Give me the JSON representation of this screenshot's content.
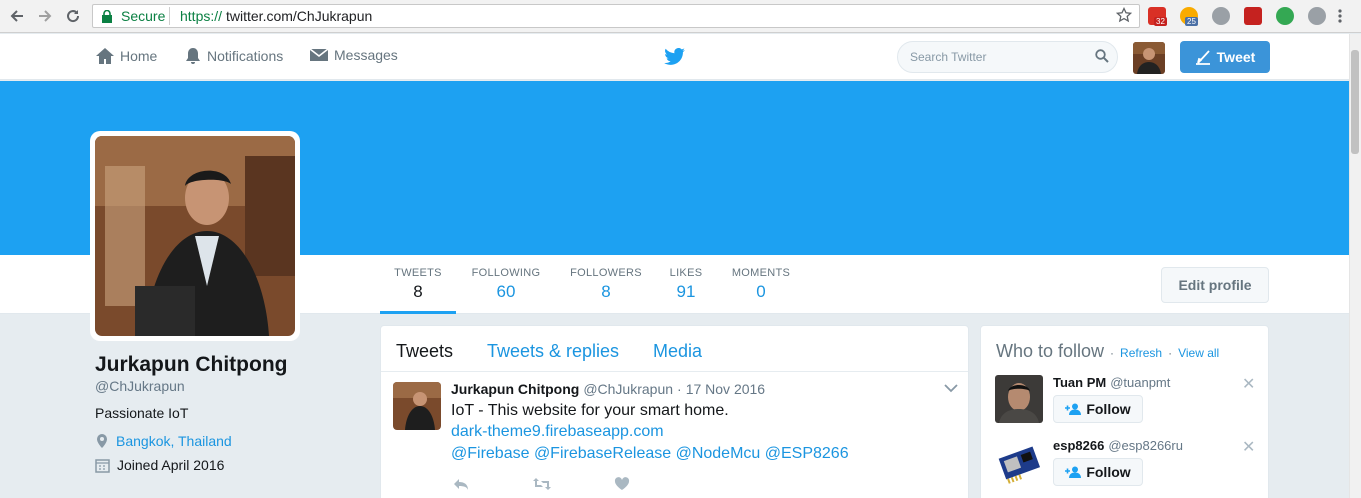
{
  "browser": {
    "secure_label": "Secure",
    "url_protocol": "https://",
    "url_rest": "twitter.com/ChJukrapun",
    "ext_badges": [
      "32",
      "25"
    ]
  },
  "topnav": {
    "home": "Home",
    "notifications": "Notifications",
    "messages": "Messages",
    "search_placeholder": "Search Twitter",
    "tweet_button": "Tweet"
  },
  "colors": {
    "accent": "#1da1f2",
    "link": "#1b95e0",
    "tweet_button": "#3b94d9"
  },
  "stats": [
    {
      "label": "TWEETS",
      "value": "8"
    },
    {
      "label": "FOLLOWING",
      "value": "60"
    },
    {
      "label": "FOLLOWERS",
      "value": "8"
    },
    {
      "label": "LIKES",
      "value": "91"
    },
    {
      "label": "MOMENTS",
      "value": "0"
    }
  ],
  "edit_profile": "Edit profile",
  "profile": {
    "name": "Jurkapun Chitpong",
    "handle": "@ChJukrapun",
    "bio": "Passionate IoT",
    "location": "Bangkok, Thailand",
    "joined": "Joined April 2016"
  },
  "tabs": [
    "Tweets",
    "Tweets & replies",
    "Media"
  ],
  "tweet": {
    "name": "Jurkapun Chitpong",
    "handle": "@ChJukrapun",
    "separator": "·",
    "date": "17 Nov 2016",
    "text": "IoT - This website for your smart home.",
    "link": "dark-theme9.firebaseapp.com",
    "mentions": "@Firebase  @FirebaseRelease @NodeMcu  @ESP8266"
  },
  "who_to_follow": {
    "title": "Who to follow",
    "separator": "·",
    "refresh": "Refresh",
    "view_all": "View all",
    "dot": "·",
    "users": [
      {
        "name": "Tuan PM",
        "handle": "@tuanpmt",
        "follow": "Follow"
      },
      {
        "name": "esp8266",
        "handle": "@esp8266ru",
        "follow": "Follow"
      }
    ]
  }
}
